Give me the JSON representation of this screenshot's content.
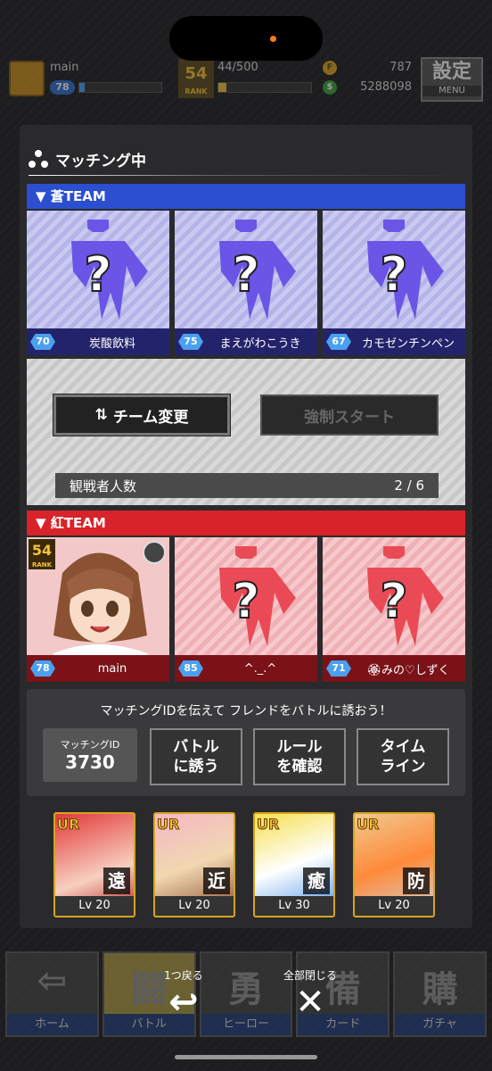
{
  "top": {
    "player_name": "main",
    "player_level": "78",
    "rank": "54",
    "rank_label": "RANK",
    "exp": "44/500",
    "coin_icon": "F",
    "coins": "787",
    "money_icon": "$",
    "money": "5288098",
    "settings_label": "設定",
    "menu_label": "MENU"
  },
  "modal": {
    "title": "マッチング中",
    "blue_team": "▼ 蒼TEAM",
    "red_team": "▼ 紅TEAM",
    "blue_slots": [
      {
        "level": "70",
        "name": "炭酸飲料"
      },
      {
        "level": "75",
        "name": "まえがわこうき"
      },
      {
        "level": "67",
        "name": "カモゼンチンペン"
      }
    ],
    "red_slots": [
      {
        "level": "78",
        "name": "main",
        "rank": "54"
      },
      {
        "level": "85",
        "name": "^._.^"
      },
      {
        "level": "71",
        "name": "🏵みの♡しずく"
      }
    ],
    "team_change_label": "チーム変更",
    "team_change_icon": "⇅",
    "force_start_label": "強制スタート",
    "spectator_label": "観戦者人数",
    "spectator_count": "2 / 6",
    "invite_text": "マッチングIDを伝えて フレンドをバトルに誘おう！",
    "match_id_label": "マッチングID",
    "match_id": "3730",
    "invite_buttons": [
      {
        "line1": "バトル",
        "line2": "に誘う"
      },
      {
        "line1": "ルール",
        "line2": "を確認"
      },
      {
        "line1": "タイム",
        "line2": "ライン"
      }
    ]
  },
  "deck": [
    {
      "rarity": "UR",
      "type": "遠",
      "level": "Lv 20",
      "color": "#d23a3a"
    },
    {
      "rarity": "UR",
      "type": "近",
      "level": "Lv 20",
      "color": "#e8a0b0"
    },
    {
      "rarity": "UR",
      "type": "癒",
      "level": "Lv 30",
      "color": "#f0d040"
    },
    {
      "rarity": "UR",
      "type": "防",
      "level": "Lv 20",
      "color": "#e07830"
    }
  ],
  "nav": [
    {
      "glyph": "⇦",
      "label": "ホーム"
    },
    {
      "glyph": "闘",
      "label": "バトル"
    },
    {
      "glyph": "勇",
      "label": "ヒーロー"
    },
    {
      "glyph": "備",
      "label": "カード"
    },
    {
      "glyph": "購",
      "label": "ガチャ"
    }
  ],
  "controls": {
    "back_label": "1つ戻る",
    "back_glyph": "↩",
    "close_label": "全部閉じる",
    "close_glyph": "✕"
  }
}
